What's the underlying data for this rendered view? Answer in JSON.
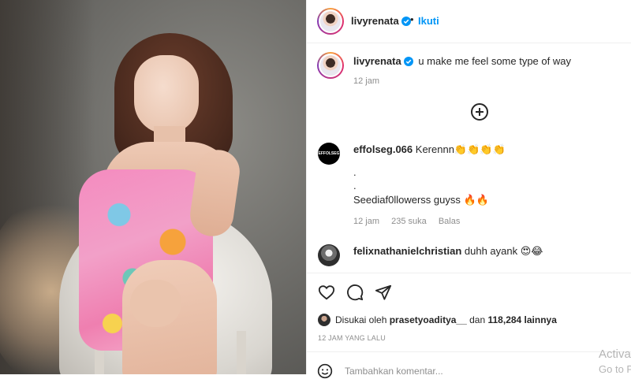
{
  "post": {
    "username": "livyrenata",
    "dot": "•",
    "follow_label": "Ikuti",
    "caption_text": "u make me feel some type of way",
    "caption_time": "12 jam"
  },
  "comments": [
    {
      "username": "effolseg.066",
      "avatar_text": "EFFOLSEG",
      "text": "Kerennn👏👏👏👏",
      "extra_lines": [
        ".",
        ".",
        "Seediaf0llowerss guyss 🔥🔥"
      ],
      "time": "12 jam",
      "likes": "235 suka",
      "reply": "Balas"
    },
    {
      "username": "felixnathanielchristian",
      "text": "duhh ayank 😍😂"
    }
  ],
  "likes": {
    "prefix": "Disukai oleh",
    "user": "prasetyoaditya__",
    "middle": "dan",
    "count": "118,284 lainnya"
  },
  "posted_label": "12 JAM YANG LALU",
  "add_comment_placeholder": "Tambahkan komentar...",
  "watermark": {
    "line1": "Activa",
    "line2": "Go to Pe"
  },
  "icons": {
    "verified": "verified-badge-icon",
    "load_more": "plus-circle-icon",
    "like": "heart-icon",
    "comment": "comment-bubble-icon",
    "share": "paper-plane-icon",
    "emoji": "smiley-icon"
  },
  "colors": {
    "accent": "#0095f6",
    "text": "#262626",
    "muted": "#8e8e8e"
  }
}
